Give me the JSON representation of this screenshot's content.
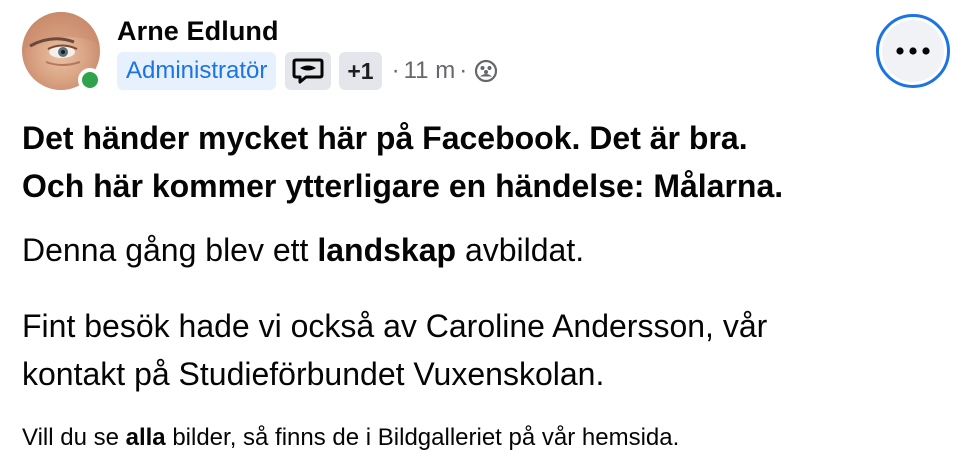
{
  "post": {
    "author": {
      "name": "Arne Edlund",
      "role_badge": "Administratör",
      "extra_badges": "+1",
      "time": "11 m",
      "separator": "·",
      "online": true,
      "audience_icon": "group-icon",
      "chat_badge_icon": "chat-bubble-icon"
    },
    "more_button_icon": "more-options-icon",
    "headline_line1": "Det händer mycket här på Facebook. Det är bra.",
    "headline_line2": "Och här kommer ytterligare en händelse: Målarna.",
    "paragraph1": {
      "before": "Denna gång blev ett ",
      "bold": "landskap",
      "after": " avbildat."
    },
    "paragraph2_line1": "Fint besök hade vi också av Caroline Andersson, vår",
    "paragraph2_line2": "kontakt på Studieförbundet Vuxenskolan.",
    "paragraph3": {
      "before": "Vill du se ",
      "bold": "alla",
      "after": " bilder, så finns de i Bildgalleriet på vår hemsida."
    }
  },
  "colors": {
    "accent": "#1b74e4",
    "admin_badge_bg": "#e7f0fd",
    "online": "#31a24c",
    "secondary_text": "#65676b",
    "badge_bg": "#e4e6eb"
  }
}
